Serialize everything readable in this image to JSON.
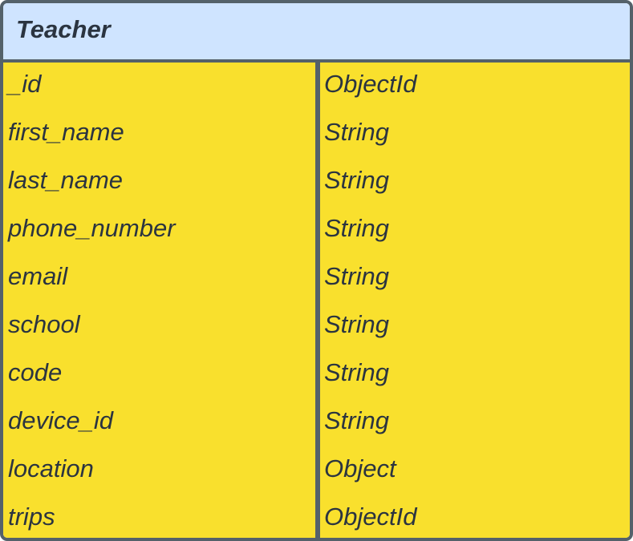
{
  "entity": {
    "title": "Teacher",
    "fields": [
      {
        "name": "_id",
        "type": "ObjectId"
      },
      {
        "name": "first_name",
        "type": "String"
      },
      {
        "name": "last_name",
        "type": "String"
      },
      {
        "name": "phone_number",
        "type": "String"
      },
      {
        "name": "email",
        "type": "String"
      },
      {
        "name": "school",
        "type": "String"
      },
      {
        "name": "code",
        "type": "String"
      },
      {
        "name": "device_id",
        "type": "String"
      },
      {
        "name": "location",
        "type": "Object"
      },
      {
        "name": "trips",
        "type": "ObjectId"
      }
    ]
  },
  "colors": {
    "header_background": "#cfe4ff",
    "body_background": "#f9e02d",
    "border": "#54616a",
    "text": "#2b3440"
  }
}
